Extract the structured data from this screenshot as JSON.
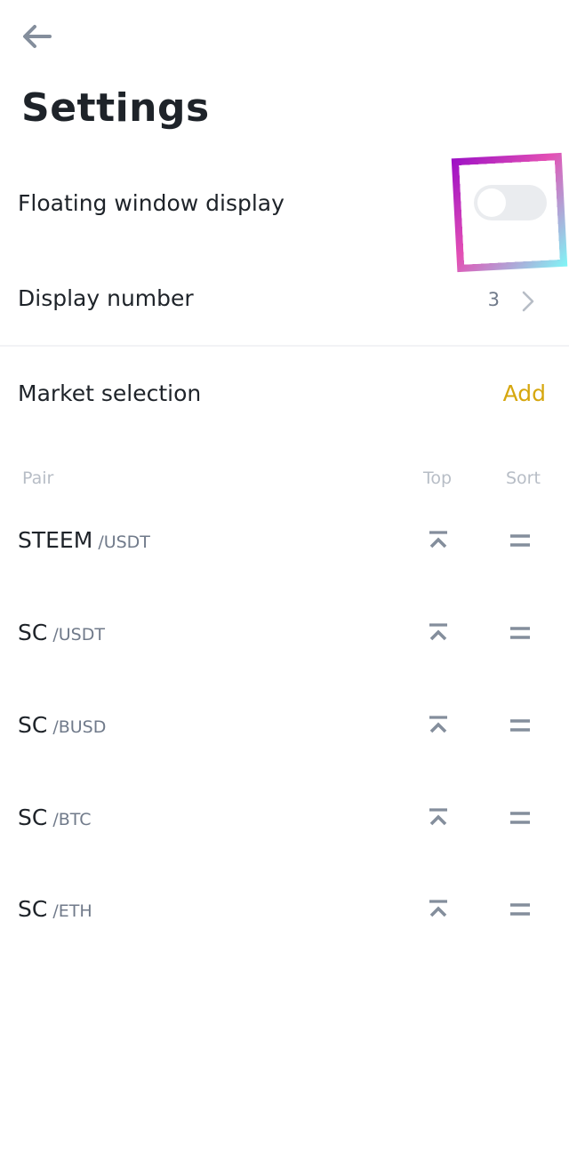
{
  "header": {
    "back_icon": "arrow-left-icon",
    "title": "Settings"
  },
  "settings": {
    "floating_window": {
      "label": "Floating window display",
      "enabled": false
    },
    "display_number": {
      "label": "Display number",
      "value": "3",
      "icon": "chevron-right-icon"
    },
    "market_selection": {
      "label": "Market selection",
      "action_label": "Add"
    }
  },
  "table": {
    "columns": {
      "pair": "Pair",
      "top": "Top",
      "sort": "Sort"
    },
    "rows": [
      {
        "base": "STEEM",
        "quote": "/USDT"
      },
      {
        "base": "SC",
        "quote": "/USDT"
      },
      {
        "base": "SC",
        "quote": "/BUSD"
      },
      {
        "base": "SC",
        "quote": "/BTC"
      },
      {
        "base": "SC",
        "quote": "/ETH"
      }
    ]
  },
  "colors": {
    "accent": "#d6a70f",
    "text_primary": "#1e2329",
    "text_secondary": "#707a8a",
    "text_muted": "#b7bdc6",
    "icon": "#848e9c",
    "toggle_off": "#eaecef"
  }
}
